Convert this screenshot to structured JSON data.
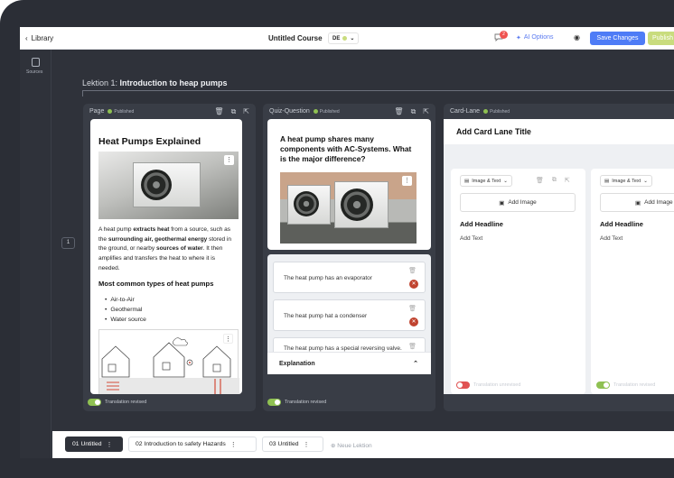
{
  "header": {
    "back_label": "Library",
    "course_title": "Untitled Course",
    "language": "DE",
    "comment_count": "2",
    "ai_label": "AI Options",
    "save_label": "Save Changes",
    "publish_label": "Publish"
  },
  "sidebar": {
    "sources_label": "Sources"
  },
  "lesson": {
    "prefix": "Lektion 1:",
    "title": "Introduction to heap pumps",
    "slide_number": "1"
  },
  "page_lane": {
    "label": "Page",
    "status": "Published",
    "heading": "Heat Pumps Explained",
    "paragraph": [
      {
        "t": "A heat pump ",
        "b": false
      },
      {
        "t": "extracts heat",
        "b": true
      },
      {
        "t": " from a source, such as the ",
        "b": false
      },
      {
        "t": "surrounding air, geothermal energy",
        "b": true
      },
      {
        "t": " stored in the ground, or nearby ",
        "b": false
      },
      {
        "t": "sources of water",
        "b": true
      },
      {
        "t": ". It then amplifies and transfers the heat to where it is needed.",
        "b": false
      }
    ],
    "subheading": "Most common types of heat pumps",
    "bullets": [
      "Air-to-Air",
      "Geothermal",
      "Water source"
    ],
    "translation": "Translation revised"
  },
  "quiz_lane": {
    "label": "Quiz-Question",
    "status": "Published",
    "question": "A heat pump shares many components with AC-Systems. What is the major difference?",
    "answers": [
      {
        "text": "The heat pump has an evaporator",
        "correct": false
      },
      {
        "text": "The heat pump hat a condenser",
        "correct": false
      },
      {
        "text": "The heat pump has a special reversing valve.",
        "correct": true
      }
    ],
    "explanation_label": "Explanation",
    "translation": "Translation revised"
  },
  "card_lane": {
    "label": "Card-Lane",
    "status": "Published",
    "title_placeholder": "Add Card Lane Title",
    "cards": [
      {
        "type": "Image & Text",
        "add_image": "Add Image",
        "headline": "Add Headline",
        "text": "Add Text",
        "translation": "Translation unrevised"
      },
      {
        "type": "Image & Text",
        "add_image": "Add Image",
        "headline": "Add Headline",
        "text": "Add Text",
        "translation": "Translation revised"
      }
    ]
  },
  "lessons_bar": {
    "tabs": [
      {
        "num": "01",
        "title": "Untitled"
      },
      {
        "num": "02",
        "title": "Introduction to safety Hazards"
      },
      {
        "num": "03",
        "title": "Untitled"
      }
    ],
    "new_label": "Neue Lektion"
  },
  "colors": {
    "accent": "#4e7cf6",
    "publish": "#c9dc7e",
    "published_dot": "#8fc152",
    "wrong": "#c0432f",
    "correct": "#a8c85a"
  }
}
